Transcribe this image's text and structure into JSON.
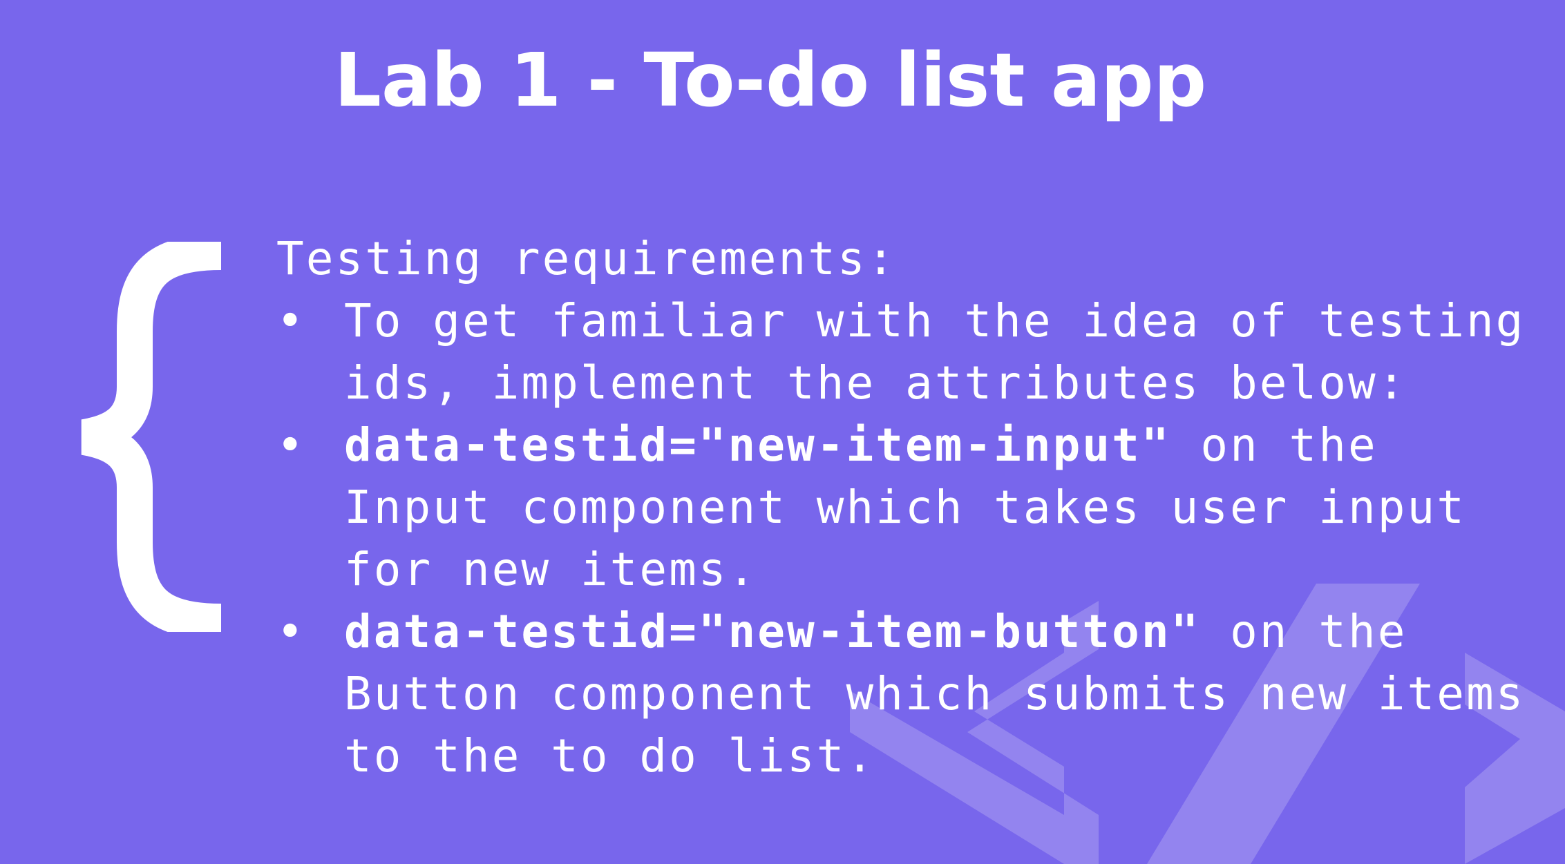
{
  "slide": {
    "title": "Lab 1 - To-do list app",
    "heading": "Testing requirements:",
    "bullets": [
      {
        "text": "To get familiar with the idea of testing ids, implement the attributes below:"
      },
      {
        "code": "data-testid=\"new-item-input\"",
        "text": " on the Input component which takes user input for new items."
      },
      {
        "code": "data-testid=\"new-item-button\"",
        "text": " on the Button component which submits new items to the to do list."
      }
    ],
    "bullet_symbol": "•",
    "colors": {
      "background": "#7866ec",
      "text": "#ffffff",
      "decoration": "#9183f0"
    },
    "icons": [
      "curly-brace-icon",
      "code-brackets-icon"
    ]
  }
}
